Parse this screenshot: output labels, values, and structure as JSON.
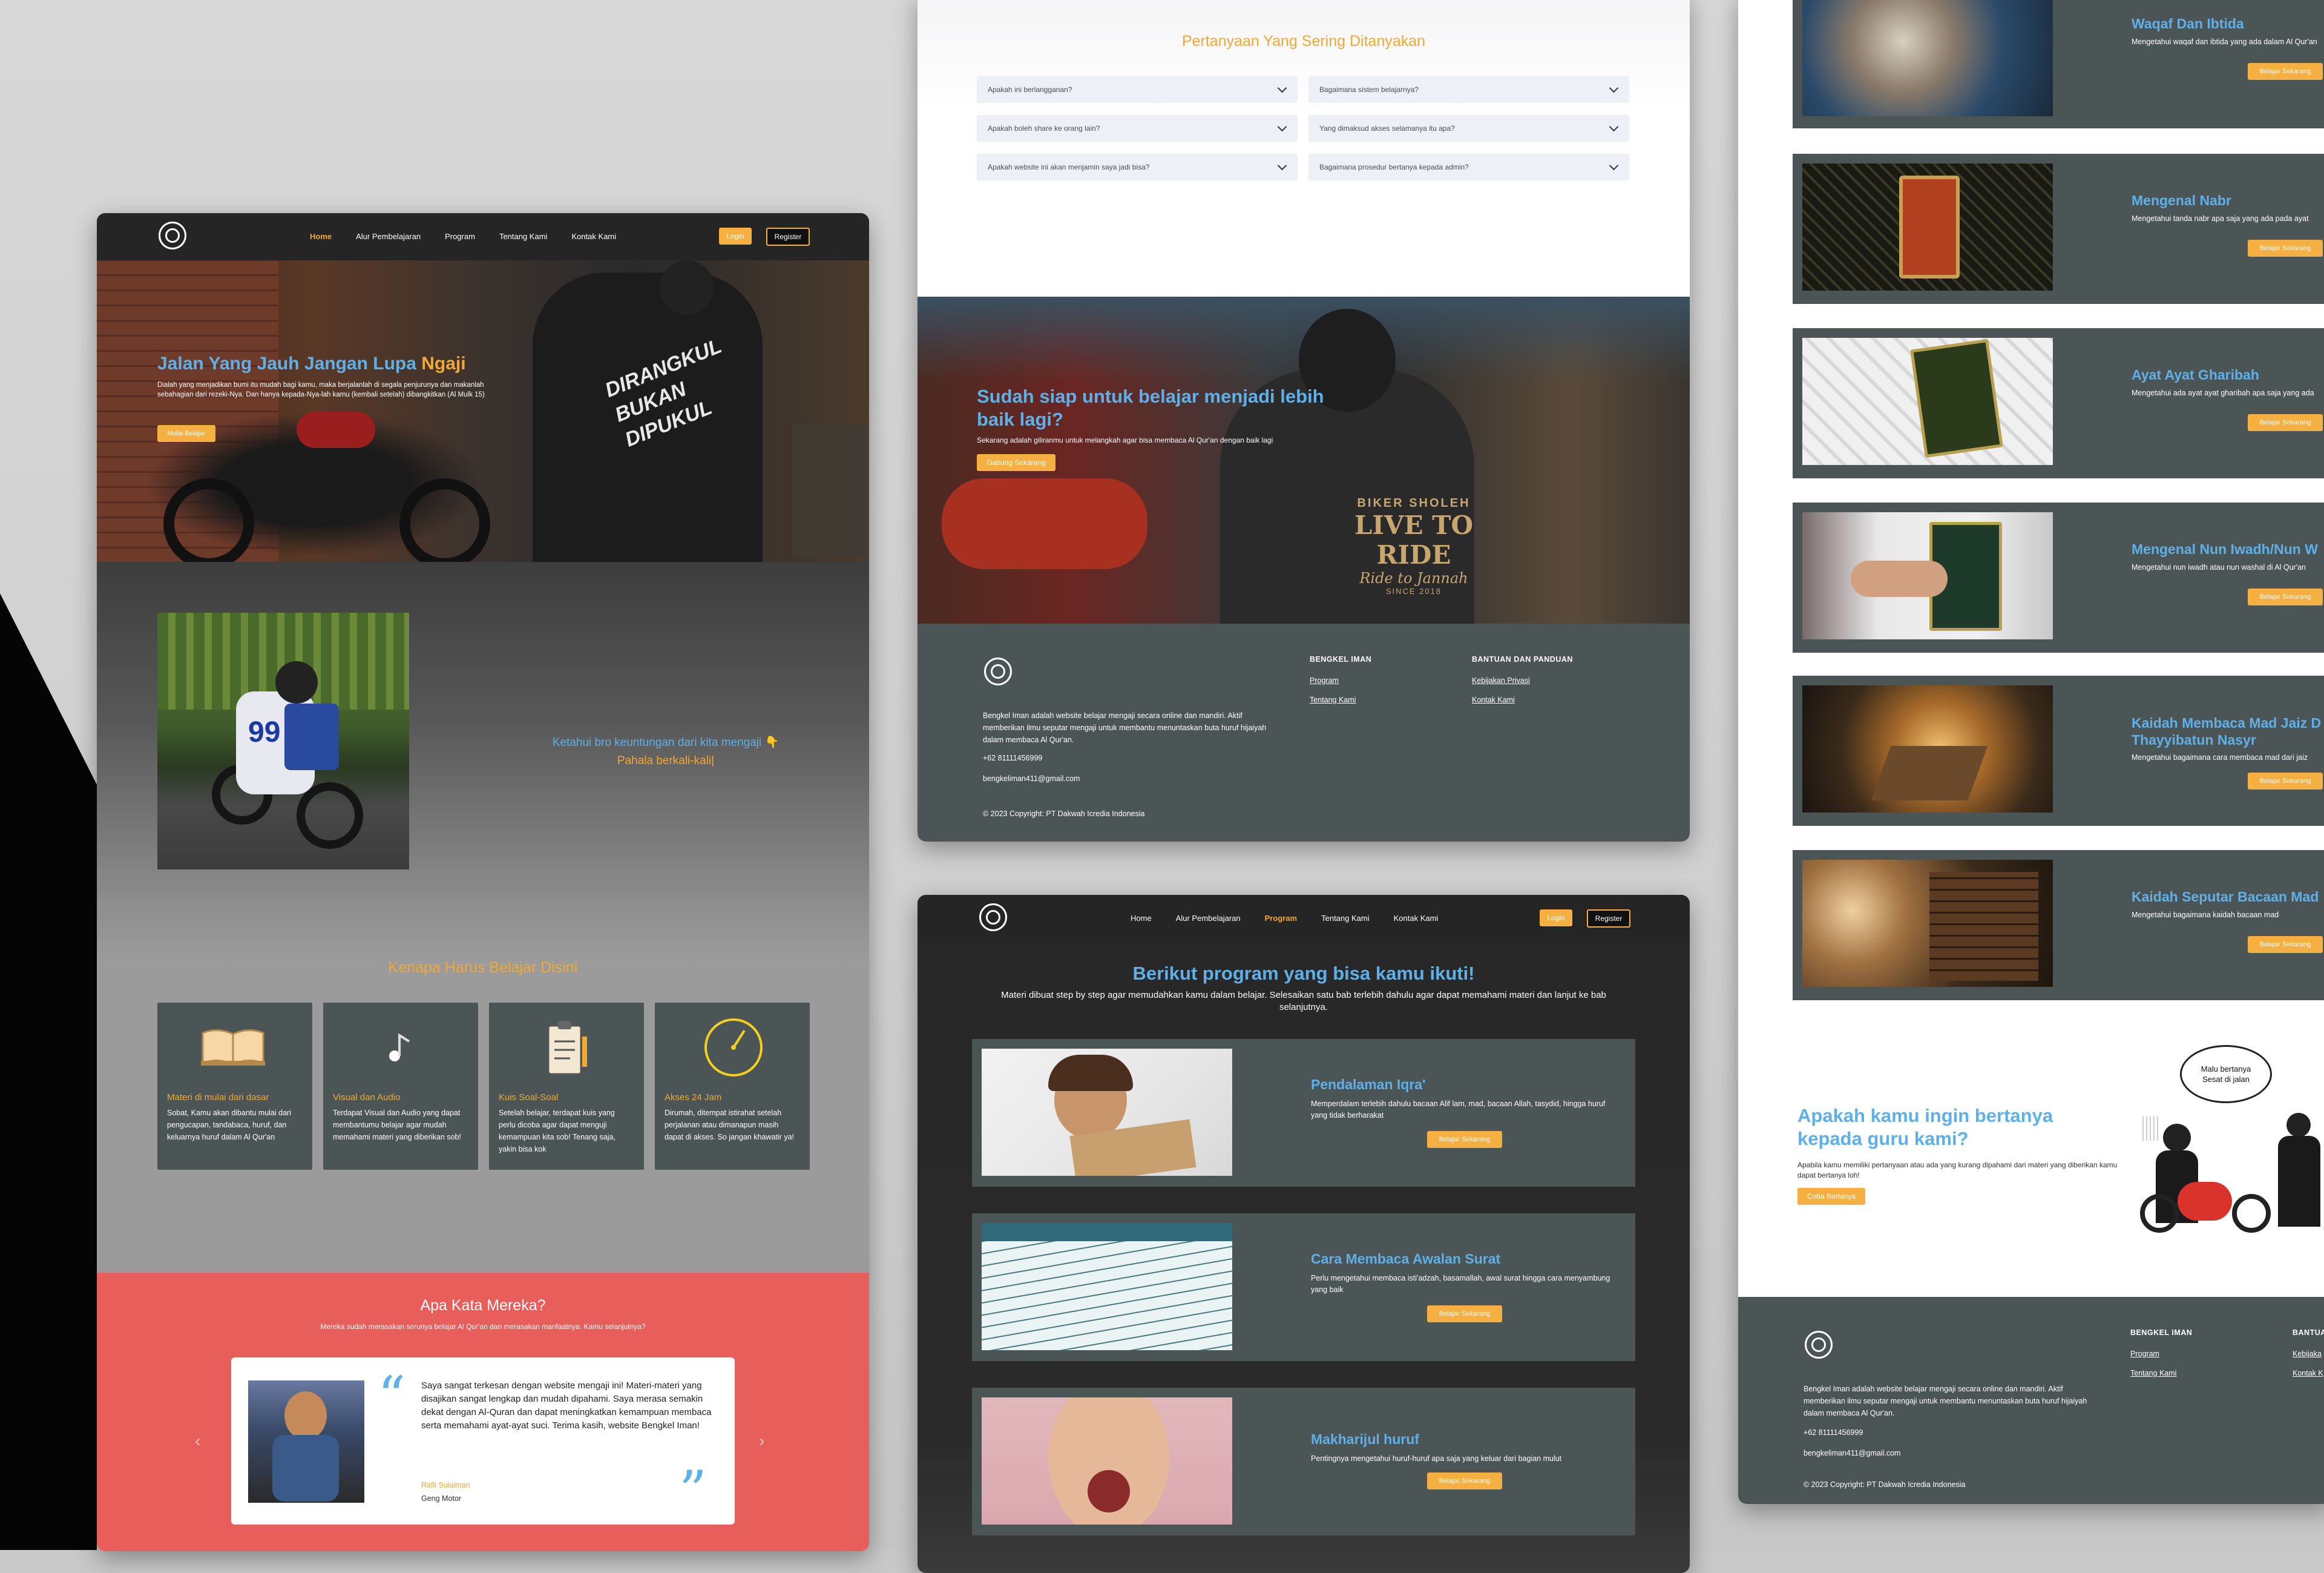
{
  "nav": {
    "home": "Home",
    "alur": "Alur Pembelajaran",
    "program": "Program",
    "tentang": "Tentang Kami",
    "kontak": "Kontak Kami",
    "login": "Login",
    "register": "Register"
  },
  "hero": {
    "title_a": "Jalan Yang Jauh Jangan Lupa ",
    "title_b": "Ngaji",
    "desc": "Dialah yang menjadikan bumi itu mudah bagi kamu, maka berjalanlah di segala penjurunya dan makanlah sebahagian dari rezeki-Nya. Dan hanya kepada-Nya-lah kamu (kembali setelah) dibangkitkan (Al Mulk 15)",
    "cta": "Mulai Belajar",
    "jacket_text": "DIRANGKUL BUKAN DIPUKUL"
  },
  "intro": {
    "line1": "Ketahui bro keuntungan dari kita mengaji 👇",
    "line2": "Pahala berkali-kali|",
    "rider_number": "99"
  },
  "why": {
    "title": "Kenapa Harus Belajar Disini",
    "cards": [
      {
        "title": "Materi di mulai dari dasar",
        "desc": "Sobat, Kamu akan dibantu mulai dari pengucapan, tandabaca, huruf, dan keluarnya huruf dalam Al Qur'an",
        "icon": "book-icon"
      },
      {
        "title": "Visual dan Audio",
        "desc": "Terdapat Visual dan Audio yang dapat membantumu belajar agar mudah memahami materi yang diberikan sob!",
        "icon": "music-note-icon"
      },
      {
        "title": "Kuis Soal-Soal",
        "desc": "Setelah belajar, terdapat kuis yang perlu dicoba agar dapat menguji kemampuan kita sob! Tenang saja, yakin bisa kok",
        "icon": "clipboard-icon"
      },
      {
        "title": "Akses 24 Jam",
        "desc": "Dirumah, ditempat istirahat setelah perjalanan atau dimanapun masih dapat di akses. So jangan khawatir ya!",
        "icon": "clock-icon"
      }
    ]
  },
  "testimonial": {
    "title": "Apa Kata Mereka?",
    "subtitle": "Mereka sudah merasakan serunya belajar Al Qur'an dan merasakan manfaatnya. Kamu selanjutnya?",
    "quote": "Saya sangat terkesan dengan website mengaji ini! Materi-materi yang disajikan sangat lengkap dan mudah dipahami. Saya merasa semakin dekat dengan Al-Quran dan dapat meningkatkan kemampuan membaca serta memahami ayat-ayat suci. Terima kasih, website Bengkel Iman!",
    "name": "Rafli Sulaiman",
    "role": "Geng Motor"
  },
  "faq": {
    "title": "Pertanyaan Yang Sering Ditanyakan",
    "items": [
      "Apakah ini berlangganan?",
      "Bagaimana sistem belajarnya?",
      "Apakah boleh share ke orang lain?",
      "Yang dimaksud akses selamanya itu apa?",
      "Apakah website ini akan menjamin saya jadi bisa?",
      "Bagaimana prosedur bertanya kepada admin?"
    ]
  },
  "cta": {
    "title": "Sudah siap untuk belajar menjadi lebih baik lagi?",
    "desc": "Sekarang adalah giliranmu untuk melangkah agar bisa membaca Al Qur'an dengan baik lagi",
    "button": "Gabung Sekarang",
    "shirt_top": "BIKER SHOLEH",
    "shirt_main": "LIVE TO RIDE",
    "shirt_sub": "Ride to Jannah",
    "shirt_since": "SINCE 2018"
  },
  "footer": {
    "about": "Bengkel Iman adalah website belajar mengaji secara online dan mandiri. Aktif memberikan ilmu seputar mengaji untuk membantu menuntaskan buta huruf hijaiyah dalam membaca Al Qur'an.",
    "phone": "+62 81111456999",
    "email": "bengkeliman411@gmail.com",
    "copyright": "© 2023 Copyright: PT Dakwah Icredia Indonesia",
    "col1_title": "BENGKEL IMAN",
    "col1_links": [
      "Program",
      "Tentang Kami"
    ],
    "col2_title": "BANTUAN DAN PANDUAN",
    "col2_links": [
      "Kebijakan Privasi",
      "Kontak Kami"
    ],
    "col2_title_cut": "BANTUA",
    "col2_links_cut": [
      "Kebijaka",
      "Kontak K"
    ]
  },
  "program": {
    "title": "Berikut program yang bisa kamu ikuti!",
    "desc": "Materi dibuat step by step agar memudahkan kamu dalam belajar. Selesaikan satu bab terlebih dahulu agar dapat memahami materi dan lanjut ke bab selanjutnya.",
    "button": "Belajar Sekarang",
    "items": [
      {
        "title": "Pendalaman Iqra'",
        "desc": "Memperdalam terlebih dahulu bacaan Alif lam, mad, bacaan Allah, tasydid, hingga huruf yang tidak berharakat"
      },
      {
        "title": "Cara Membaca Awalan Surat",
        "desc": "Perlu mengetahui membaca isti'adzah, basamallah, awal surat hingga cara menyambung yang baik"
      },
      {
        "title": "Makharijul huruf",
        "desc": "Pentingnya mengetahui huruf-huruf apa saja yang keluar dari bagian mulut"
      }
    ]
  },
  "right": {
    "items": [
      {
        "title": "Waqaf Dan Ibtida",
        "desc": "Mengetahui waqaf dan ibtida yang ada dalam Al Qur'an"
      },
      {
        "title": "Mengenal Nabr",
        "desc": "Mengetahui tanda nabr apa saja yang ada pada ayat"
      },
      {
        "title": "Ayat Ayat Gharibah",
        "desc": "Mengetahui ada ayat ayat gharibah apa saja yang ada"
      },
      {
        "title": "Mengenal Nun Iwadh/Nun W",
        "desc": "Mengetahui nun iwadh atau nun washal di Al Qur'an"
      },
      {
        "title": "Kaidah Membaca Mad Jaiz D Thayyibatun Nasyr",
        "desc": "Mengetahui bagaimana cara membaca mad dari jaiz"
      },
      {
        "title": "Kaidah Seputar Bacaan Mad",
        "desc": "Mengetahui bagaimana kaidah bacaan mad"
      }
    ],
    "ask_title": "Apakah kamu ingin bertanya kepada guru kami?",
    "ask_desc": "Apabila kamu memiliki pertanyaan atau ada yang kurang dipahami dari materi yang diberikan kamu dapat bertanya loh!",
    "ask_button": "Coba Bertanya",
    "bubble": "Malu bertanya Sesat di jalan"
  }
}
